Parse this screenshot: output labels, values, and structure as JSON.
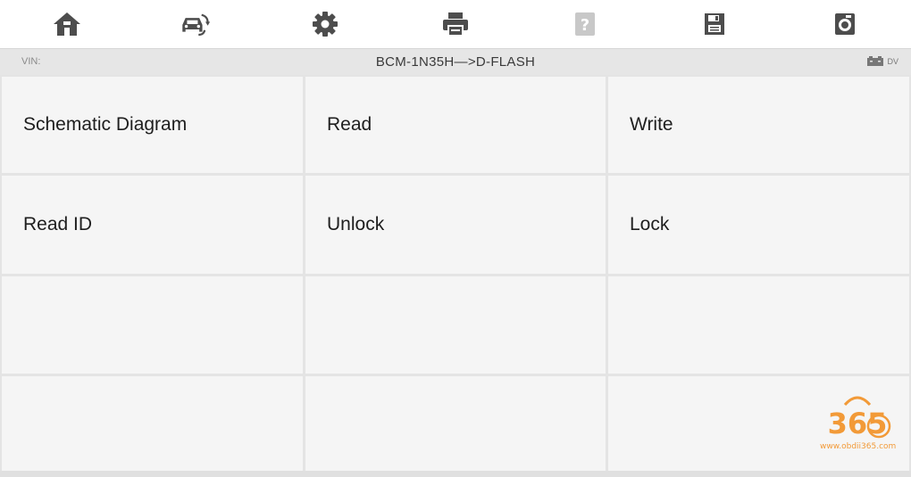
{
  "toolbar": {
    "icons": [
      "home-icon",
      "vehicle-swap-icon",
      "settings-icon",
      "print-icon",
      "help-icon",
      "save-icon",
      "screenshot-icon"
    ],
    "help_disabled": true
  },
  "status": {
    "vin_label": "VIN:",
    "path_title": "BCM-1N35H—>D-FLASH",
    "power_label": "DV"
  },
  "menu": {
    "items": [
      {
        "label": "Schematic Diagram"
      },
      {
        "label": "Read"
      },
      {
        "label": "Write"
      },
      {
        "label": "Read ID"
      },
      {
        "label": "Unlock"
      },
      {
        "label": "Lock"
      }
    ]
  },
  "watermark": {
    "logo_text": "365",
    "url": "www.obdii365.com"
  },
  "colors": {
    "icon": "#4d4d4d",
    "icon_disabled": "#c8c8c8",
    "watermark": "#f29a38"
  }
}
